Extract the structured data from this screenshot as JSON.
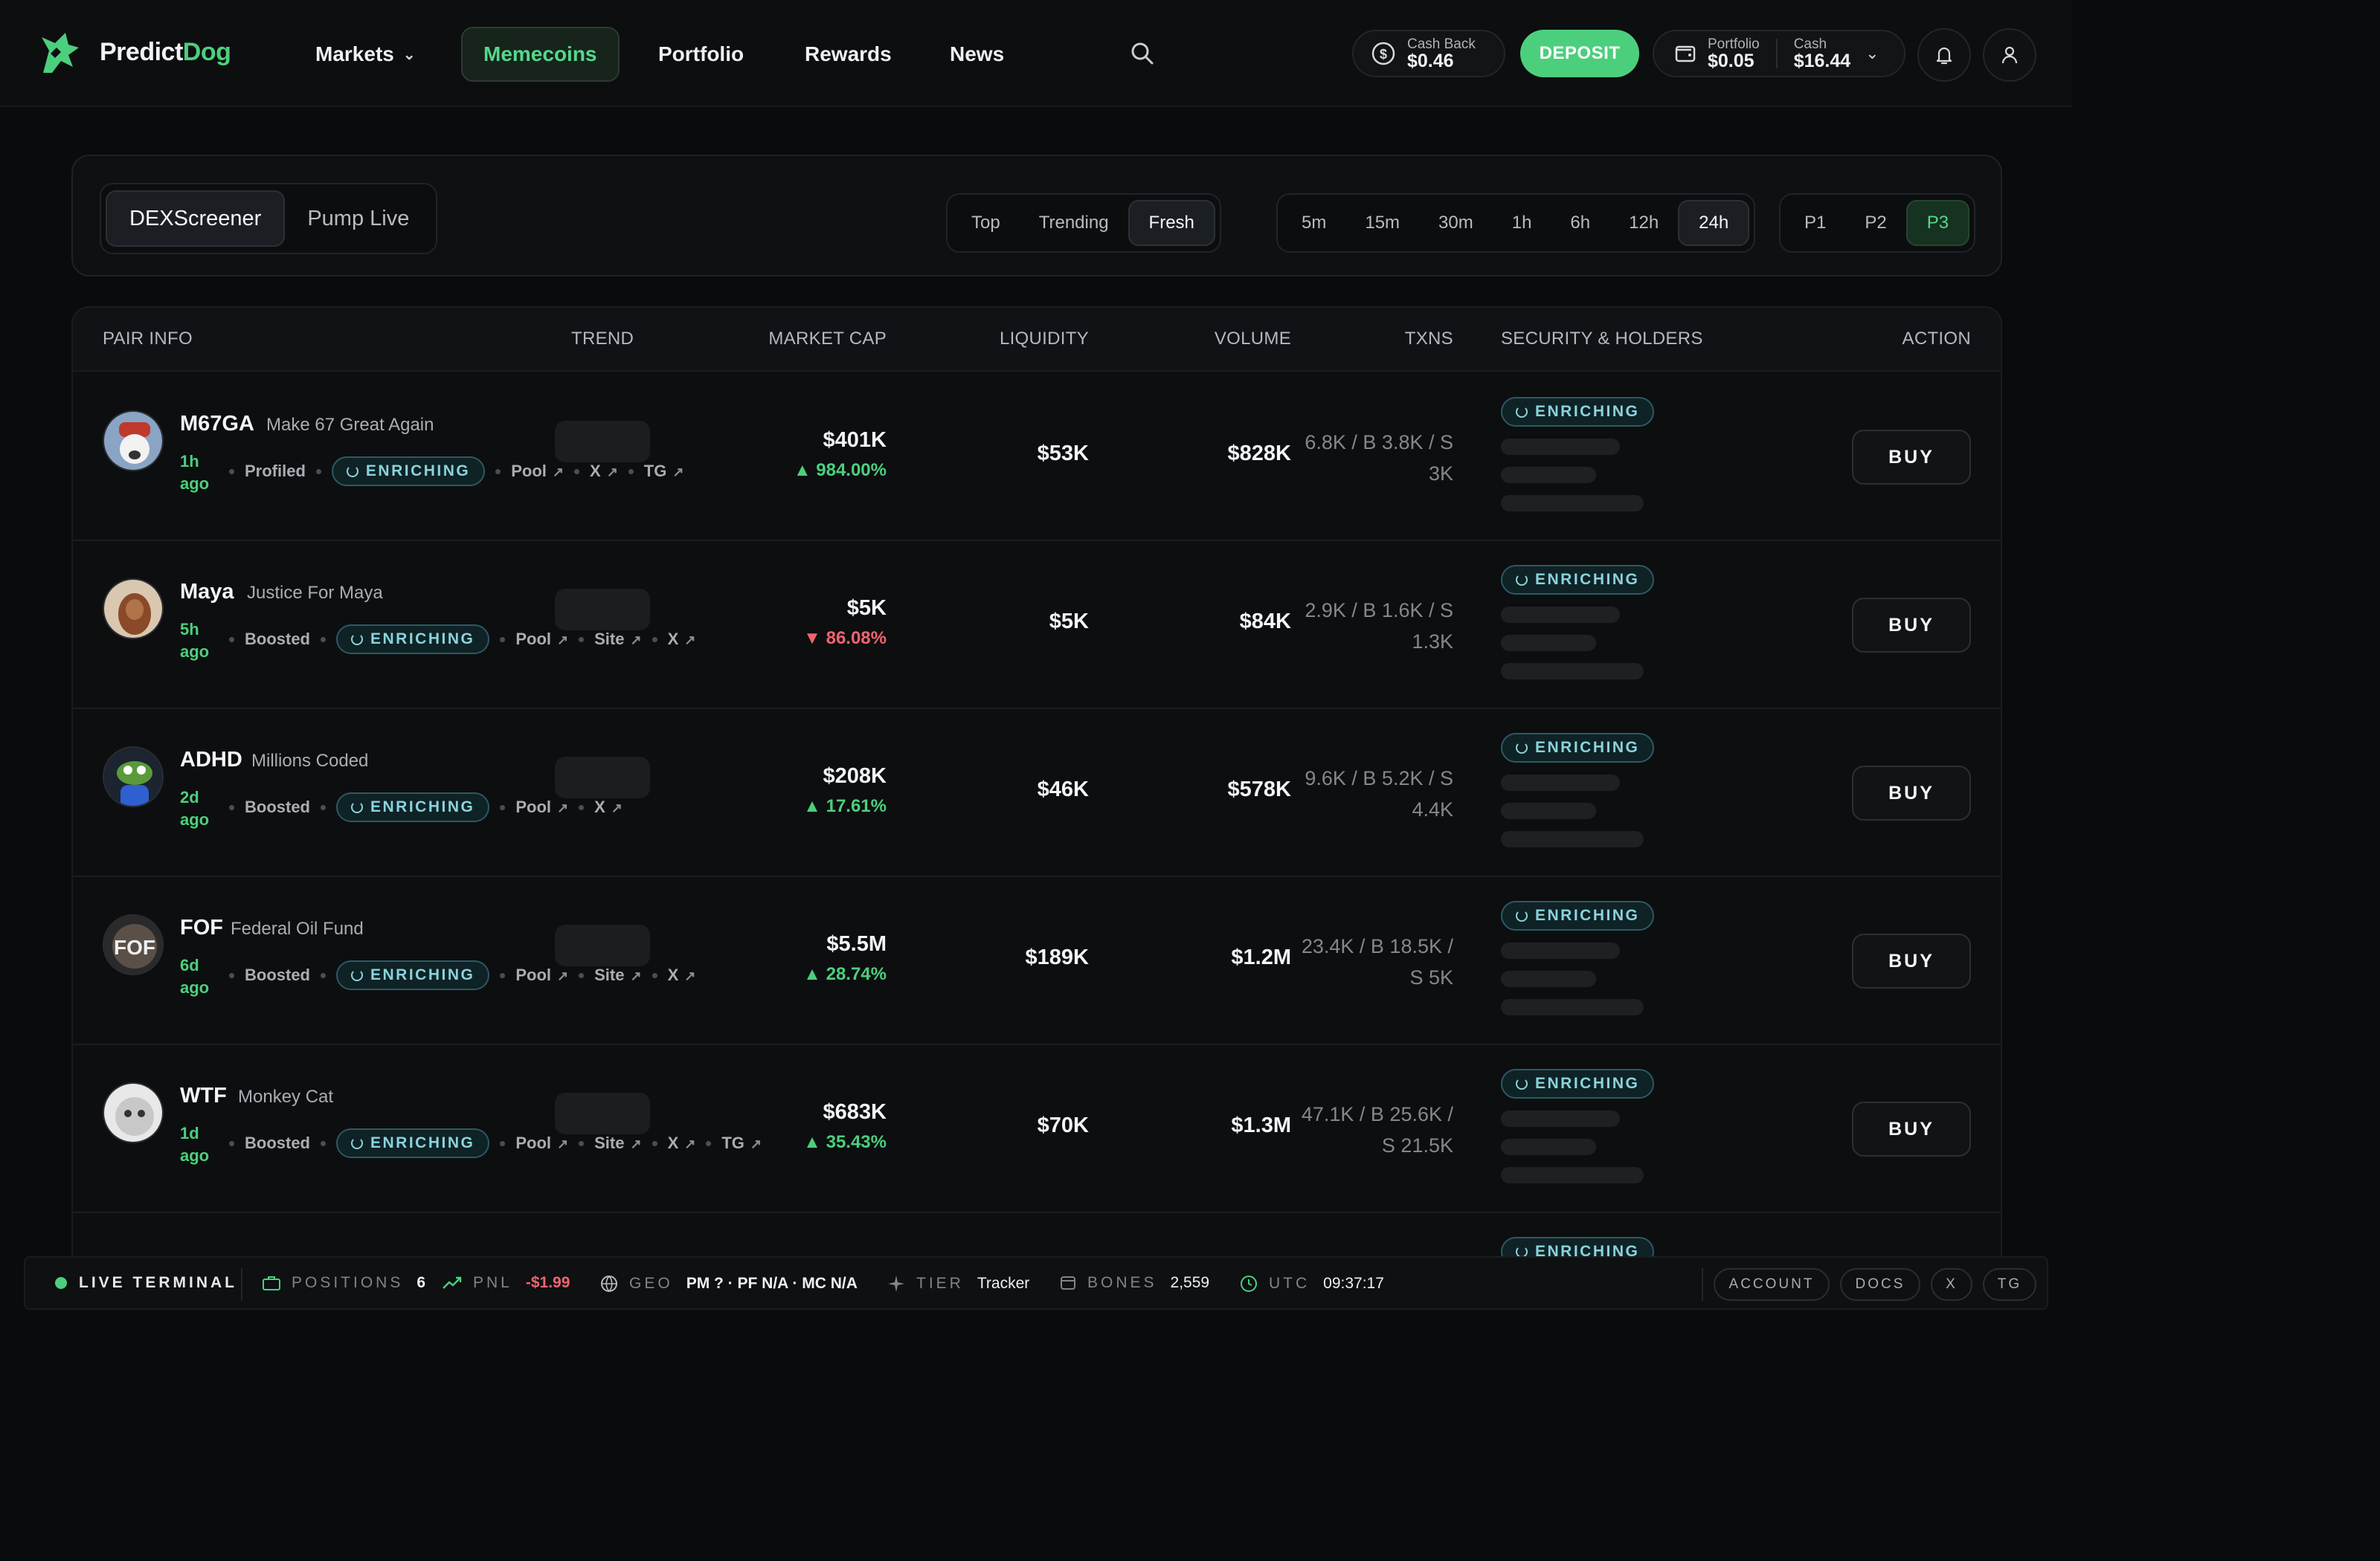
{
  "app": {
    "brand_a": "Predict",
    "brand_b": "Dog"
  },
  "nav": {
    "markets": "Markets",
    "memecoins": "Memecoins",
    "portfolio": "Portfolio",
    "rewards": "Rewards",
    "news": "News"
  },
  "header": {
    "cashback_label": "Cash Back",
    "cashback_value": "$0.46",
    "deposit": "DEPOSIT",
    "portfolio_label": "Portfolio",
    "portfolio_value": "$0.05",
    "cash_label": "Cash",
    "cash_value": "$16.44"
  },
  "filters": {
    "source": [
      "DEXScreener",
      "Pump Live"
    ],
    "sort": [
      "Top",
      "Trending",
      "Fresh"
    ],
    "timeframes": [
      "5m",
      "15m",
      "30m",
      "1h",
      "6h",
      "12h",
      "24h"
    ],
    "pages": [
      "P1",
      "P2",
      "P3"
    ]
  },
  "table": {
    "headers": [
      "PAIR INFO",
      "TREND",
      "MARKET CAP",
      "LIQUIDITY",
      "VOLUME",
      "TXNS",
      "SECURITY & HOLDERS",
      "ACTION"
    ],
    "enriching": "ENRICHING",
    "buy": "BUY",
    "rows": [
      {
        "ticker": "M67GA",
        "name": "Make 67 Great Again",
        "age": "1h ago",
        "tag": "Profiled",
        "links": [
          "Pool",
          "X",
          "TG"
        ],
        "mcap": "$401K",
        "change": "▲ 984.00%",
        "dir": "up",
        "liq": "$53K",
        "vol": "$828K",
        "txns": "6.8K / B 3.8K / S 3K"
      },
      {
        "ticker": "Maya",
        "name": "Justice For Maya",
        "age": "5h ago",
        "tag": "Boosted",
        "links": [
          "Pool",
          "Site",
          "X"
        ],
        "mcap": "$5K",
        "change": "▼ 86.08%",
        "dir": "down",
        "liq": "$5K",
        "vol": "$84K",
        "txns": "2.9K / B 1.6K / S 1.3K"
      },
      {
        "ticker": "ADHD",
        "name": "Millions Coded",
        "age": "2d ago",
        "tag": "Boosted",
        "links": [
          "Pool",
          "X"
        ],
        "mcap": "$208K",
        "change": "▲ 17.61%",
        "dir": "up",
        "liq": "$46K",
        "vol": "$578K",
        "txns": "9.6K / B 5.2K / S 4.4K"
      },
      {
        "ticker": "FOF",
        "name": "Federal Oil Fund",
        "age": "6d ago",
        "tag": "Boosted",
        "links": [
          "Pool",
          "Site",
          "X"
        ],
        "mcap": "$5.5M",
        "change": "▲ 28.74%",
        "dir": "up",
        "liq": "$189K",
        "vol": "$1.2M",
        "txns": "23.4K / B 18.5K / S 5K"
      },
      {
        "ticker": "WTF",
        "name": "Monkey Cat",
        "age": "1d ago",
        "tag": "Boosted",
        "links": [
          "Pool",
          "Site",
          "X",
          "TG"
        ],
        "mcap": "$683K",
        "change": "▲ 35.43%",
        "dir": "up",
        "liq": "$70K",
        "vol": "$1.3M",
        "txns": "47.1K / B 25.6K / S 21.5K"
      }
    ]
  },
  "statusbar": {
    "live": "LIVE TERMINAL",
    "positions_k": "POSITIONS",
    "positions_v": "6",
    "pnl_k": "PNL",
    "pnl_v": "-$1.99",
    "geo_k": "GEO",
    "geo_v": "PM ? · PF N/A · MC N/A",
    "tier_k": "TIER",
    "tier_v": "Tracker",
    "bones_k": "BONES",
    "bones_v": "2,559",
    "utc_k": "UTC",
    "utc_v": "09:37:17",
    "buttons": [
      "ACCOUNT",
      "DOCS",
      "X",
      "TG"
    ]
  },
  "colors": {
    "accent": "#4ccf7d",
    "negative": "#f0646e",
    "enrich": "#8ad3dc",
    "bg": "#0a0b0d"
  },
  "icons": [
    "logo-dog-icon",
    "chevron-down-icon",
    "search-icon",
    "dollar-coin-icon",
    "wallet-icon",
    "bell-icon",
    "user-icon",
    "external-link-icon",
    "spinner-icon",
    "briefcase-icon",
    "trend-up-icon",
    "globe-icon",
    "sparkle-icon",
    "bones-icon",
    "clock-icon"
  ]
}
